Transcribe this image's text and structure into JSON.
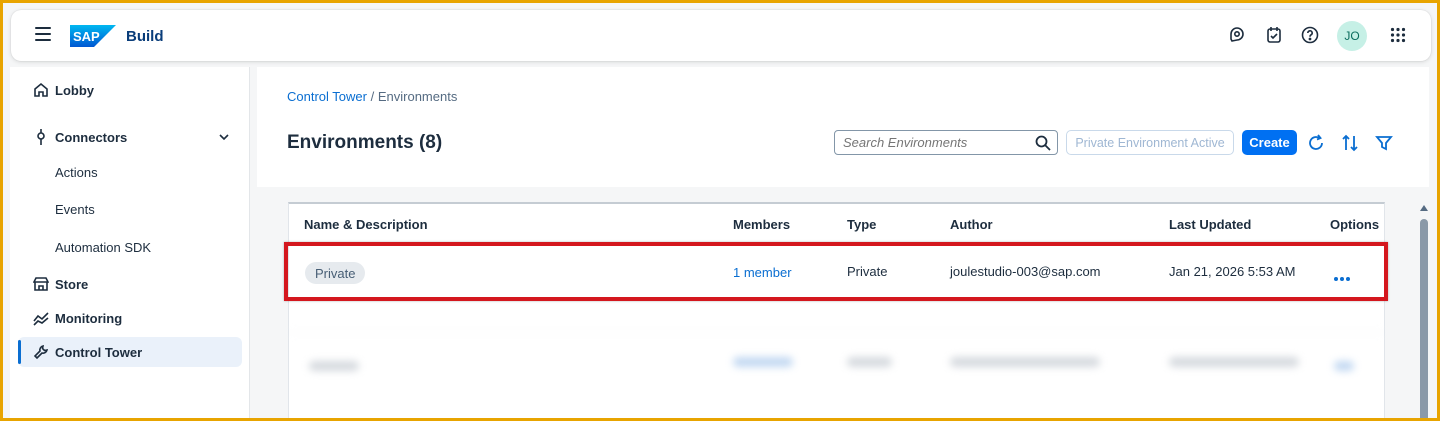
{
  "shellbar": {
    "brand_logo": "SAP",
    "app_title": "Build",
    "avatar_initials": "JO",
    "icons": [
      "menu-icon",
      "joule-icon",
      "notifications-icon",
      "help-icon",
      "apps-grid-icon"
    ]
  },
  "sidebar": {
    "items": [
      {
        "label": "Lobby",
        "icon": "home-icon"
      },
      {
        "label": "Connectors",
        "icon": "connector-icon"
      },
      {
        "label": "Actions"
      },
      {
        "label": "Events"
      },
      {
        "label": "Automation SDK"
      },
      {
        "label": "Store",
        "icon": "store-icon"
      },
      {
        "label": "Monitoring",
        "icon": "monitoring-icon"
      },
      {
        "label": "Control Tower",
        "icon": "wrench-icon",
        "active": true
      }
    ]
  },
  "breadcrumb": {
    "root": "Control Tower",
    "separator": "/",
    "current": "Environments"
  },
  "page": {
    "title": "Environments (8)"
  },
  "toolbar": {
    "search_placeholder": "Search Environments",
    "private_env_label": "Private Environment Active",
    "create_label": "Create"
  },
  "table": {
    "columns": [
      "Name & Description",
      "Members",
      "Type",
      "Author",
      "Last Updated",
      "Options"
    ],
    "rows": [
      {
        "name_tag": "Private",
        "members": "1 member",
        "type": "Private",
        "author": "joulestudio-003@sap.com",
        "last_updated": "Jan 21, 2026 5:53 AM"
      }
    ]
  },
  "colors": {
    "accent": "#0070f2",
    "highlight": "#d4171e",
    "frame": "#e8a400"
  }
}
